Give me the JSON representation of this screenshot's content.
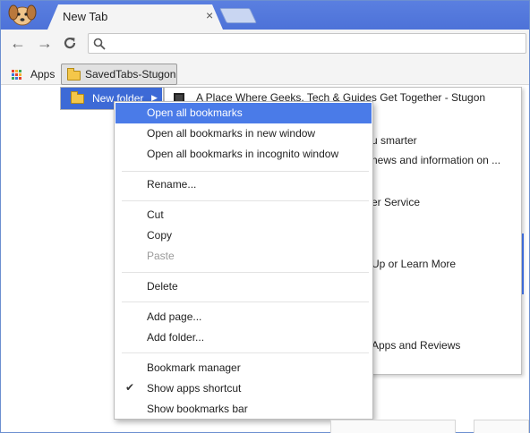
{
  "tab": {
    "title": "New Tab",
    "close": "×"
  },
  "toolbar": {
    "back": "←",
    "forward": "→",
    "reload": "C",
    "omnibox_value": ""
  },
  "bookmarks_bar": {
    "apps_label": "Apps",
    "folder_label": "SavedTabs-Stugon"
  },
  "folder_menu": {
    "item_label": "New folder",
    "arrow": "▶"
  },
  "submenu": {
    "first_item": "A Place Where Geeks, Tech & Guides Get Together - Stugon",
    "partial_items": [
      "u smarter",
      "news and information on ...",
      "er Service",
      "Up or Learn More",
      "Apps and Reviews"
    ]
  },
  "context_menu": {
    "open_all": "Open all bookmarks",
    "open_all_new_window": "Open all bookmarks in new window",
    "open_all_incognito": "Open all bookmarks in incognito window",
    "rename": "Rename...",
    "cut": "Cut",
    "copy": "Copy",
    "paste": "Paste",
    "delete": "Delete",
    "add_page": "Add page...",
    "add_folder": "Add folder...",
    "bookmark_manager": "Bookmark manager",
    "show_apps_shortcut": "Show apps shortcut",
    "show_bookmarks_bar": "Show bookmarks bar",
    "checkmark": "✔"
  },
  "colors": {
    "titlebar": "#4d72d8",
    "highlight": "#4a7be8",
    "folder": "#f4c74a"
  },
  "icons": {
    "avatar": "dog-avatar-icon",
    "search": "search-icon",
    "apps": "apps-grid-icon",
    "folder": "folder-icon"
  }
}
